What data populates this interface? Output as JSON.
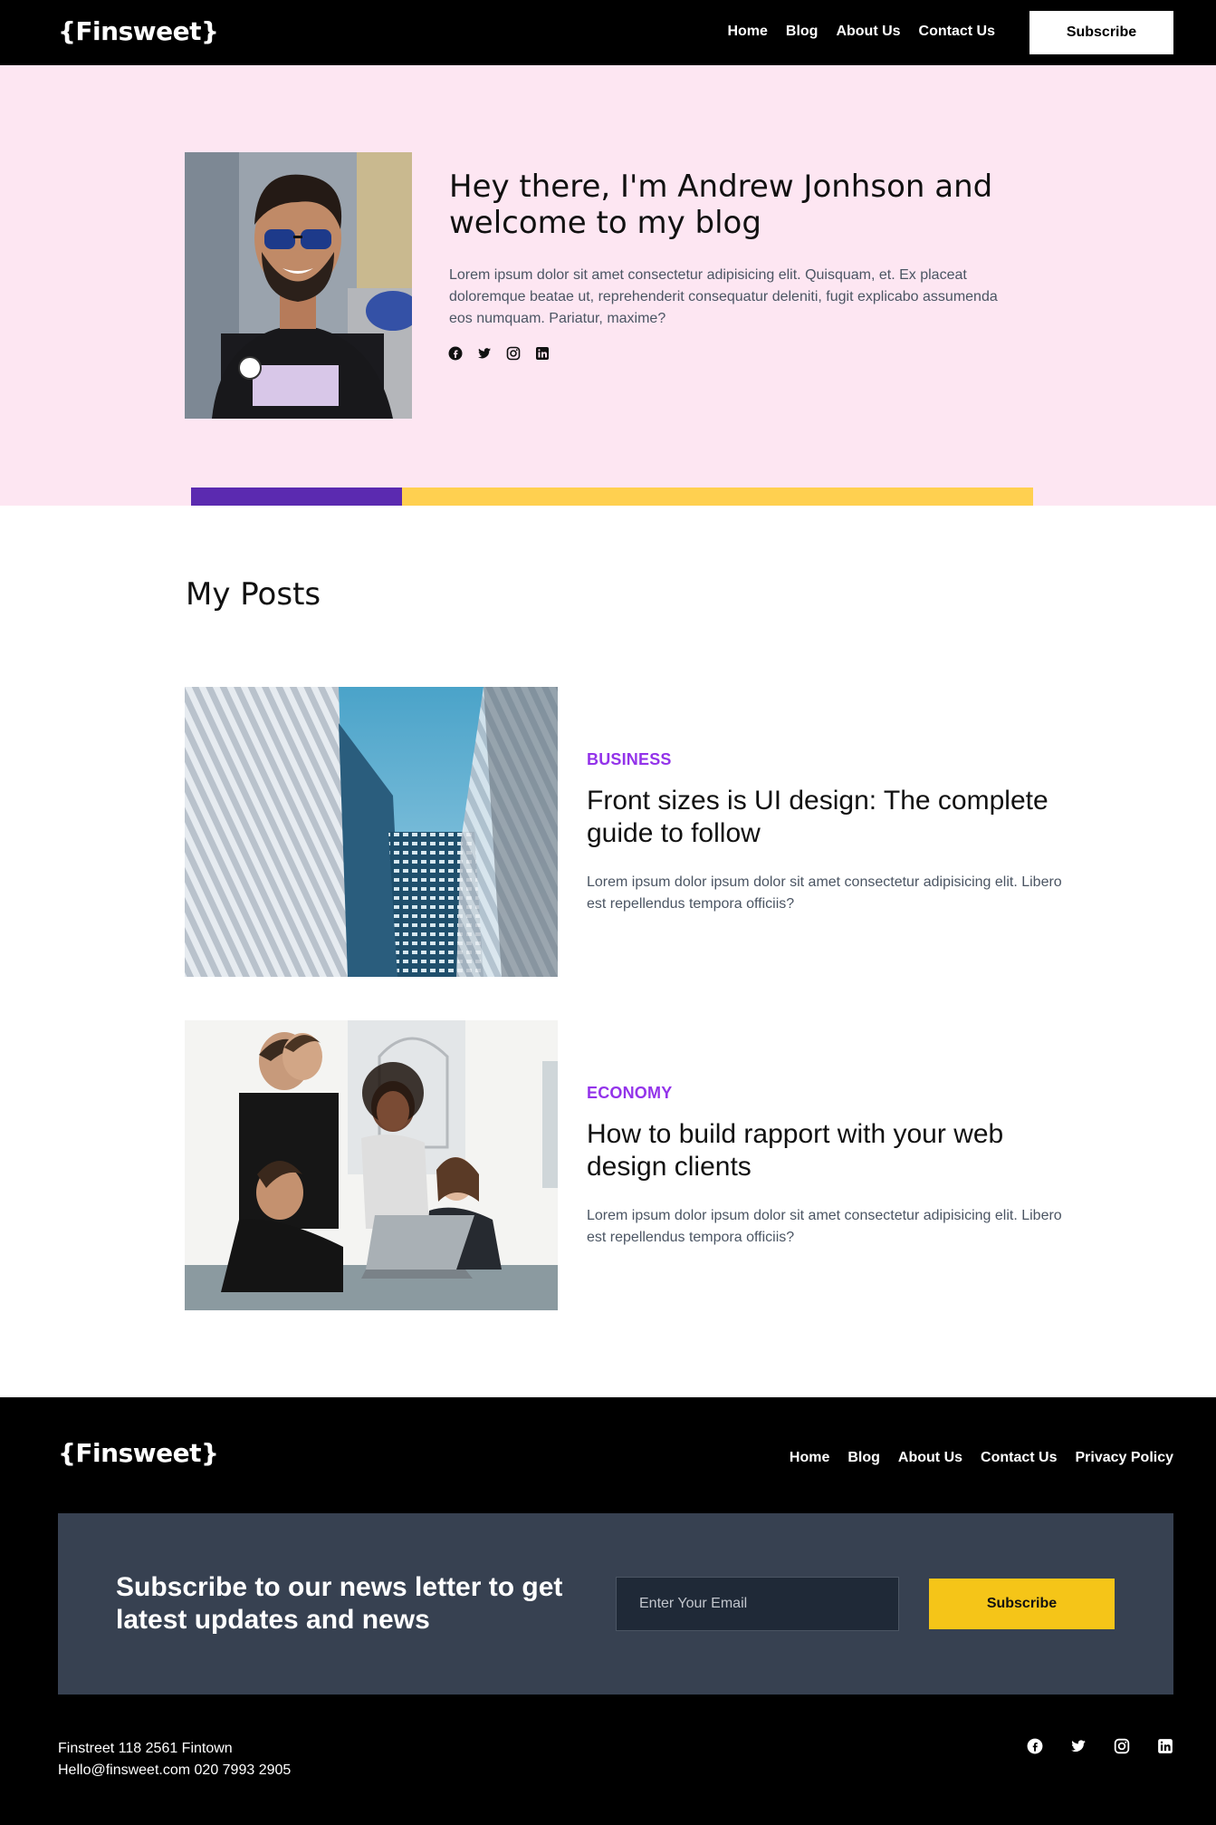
{
  "brand": {
    "logo": "{Finsweet}"
  },
  "header": {
    "nav": [
      "Home",
      "Blog",
      "About Us",
      "Contact Us"
    ],
    "subscribe_label": "Subscribe"
  },
  "hero": {
    "title": "Hey there, I'm Andrew Jonhson and welcome to my blog",
    "text": "Lorem ipsum dolor sit amet consectetur adipisicing elit. Quisquam, et. Ex placeat doloremque beatae ut, reprehenderit consequatur deleniti, fugit explicabo assumenda eos numquam. Pariatur, maxime?",
    "socials": [
      "facebook-icon",
      "twitter-icon",
      "instagram-icon",
      "linkedin-icon"
    ]
  },
  "posts": {
    "heading": "My Posts",
    "items": [
      {
        "category": "BUSINESS",
        "title": "Front sizes is UI design: The complete guide to follow",
        "text": "Lorem ipsum dolor ipsum dolor sit amet consectetur adipisicing elit. Libero est repellendus tempora officiis?"
      },
      {
        "category": "ECONOMY",
        "title": "How to build rapport with your web design clients",
        "text": "Lorem ipsum dolor ipsum dolor sit amet consectetur adipisicing elit. Libero est repellendus tempora officiis?"
      }
    ]
  },
  "footer": {
    "nav": [
      "Home",
      "Blog",
      "About Us",
      "Contact Us",
      "Privacy Policy"
    ],
    "newsletter": {
      "title": "Subscribe to our news letter to get latest updates and news",
      "placeholder": "Enter Your Email",
      "button": "Subscribe"
    },
    "address_line1": "Finstreet 118 2561 Fintown",
    "address_line2": "Hello@finsweet.com 020 7993 2905"
  },
  "colors": {
    "hero_bg": "#fde6f2",
    "accent_purple": "#5b2ab0",
    "accent_yellow": "#ffd050",
    "category": "#9333ea",
    "newsletter_bg": "#374151",
    "newsletter_button": "#f5c518"
  }
}
